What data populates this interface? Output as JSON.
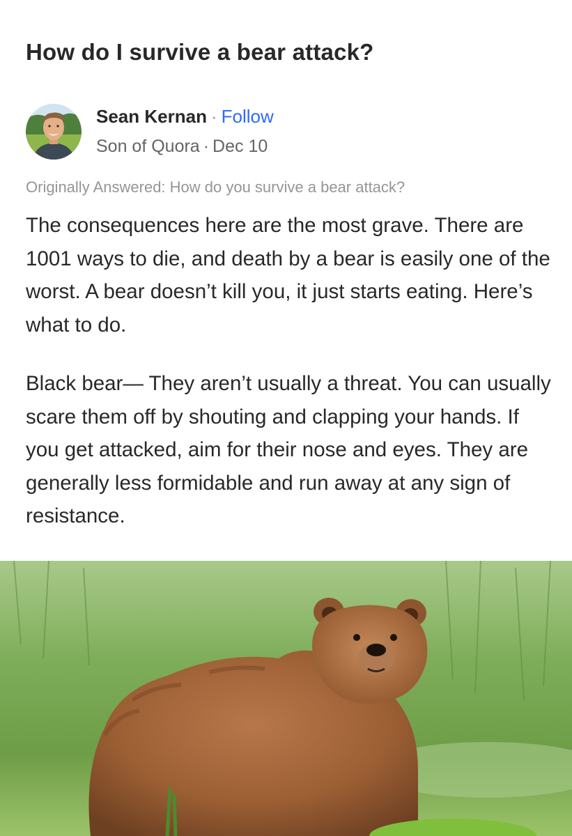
{
  "question": {
    "title": "How do I survive a bear attack?"
  },
  "author": {
    "name": "Sean Kernan",
    "separator": "·",
    "follow_label": "Follow",
    "credential": "Son of Quora",
    "date": "Dec 10",
    "avatar_icon": "profile-photo"
  },
  "answer": {
    "originally_answered": "Originally Answered: How do you survive a bear attack?",
    "paragraphs": [
      "The consequences here are the most grave. There are 1001 ways to die, and death by a bear is easily one of the worst. A bear doesn’t kill you, it just starts eating. Here’s what to do.",
      "Black bear— They aren’t usually a threat. You can usually scare them off by shouting and clapping your hands. If you get attacked, aim for their nose and eyes. They are generally less formidable and run away at any sign of resistance."
    ],
    "image_subject": "brown-bear-photo"
  },
  "colors": {
    "text_primary": "#282829",
    "text_secondary": "#636466",
    "text_muted": "#939598",
    "link_blue": "#2e69ff"
  }
}
